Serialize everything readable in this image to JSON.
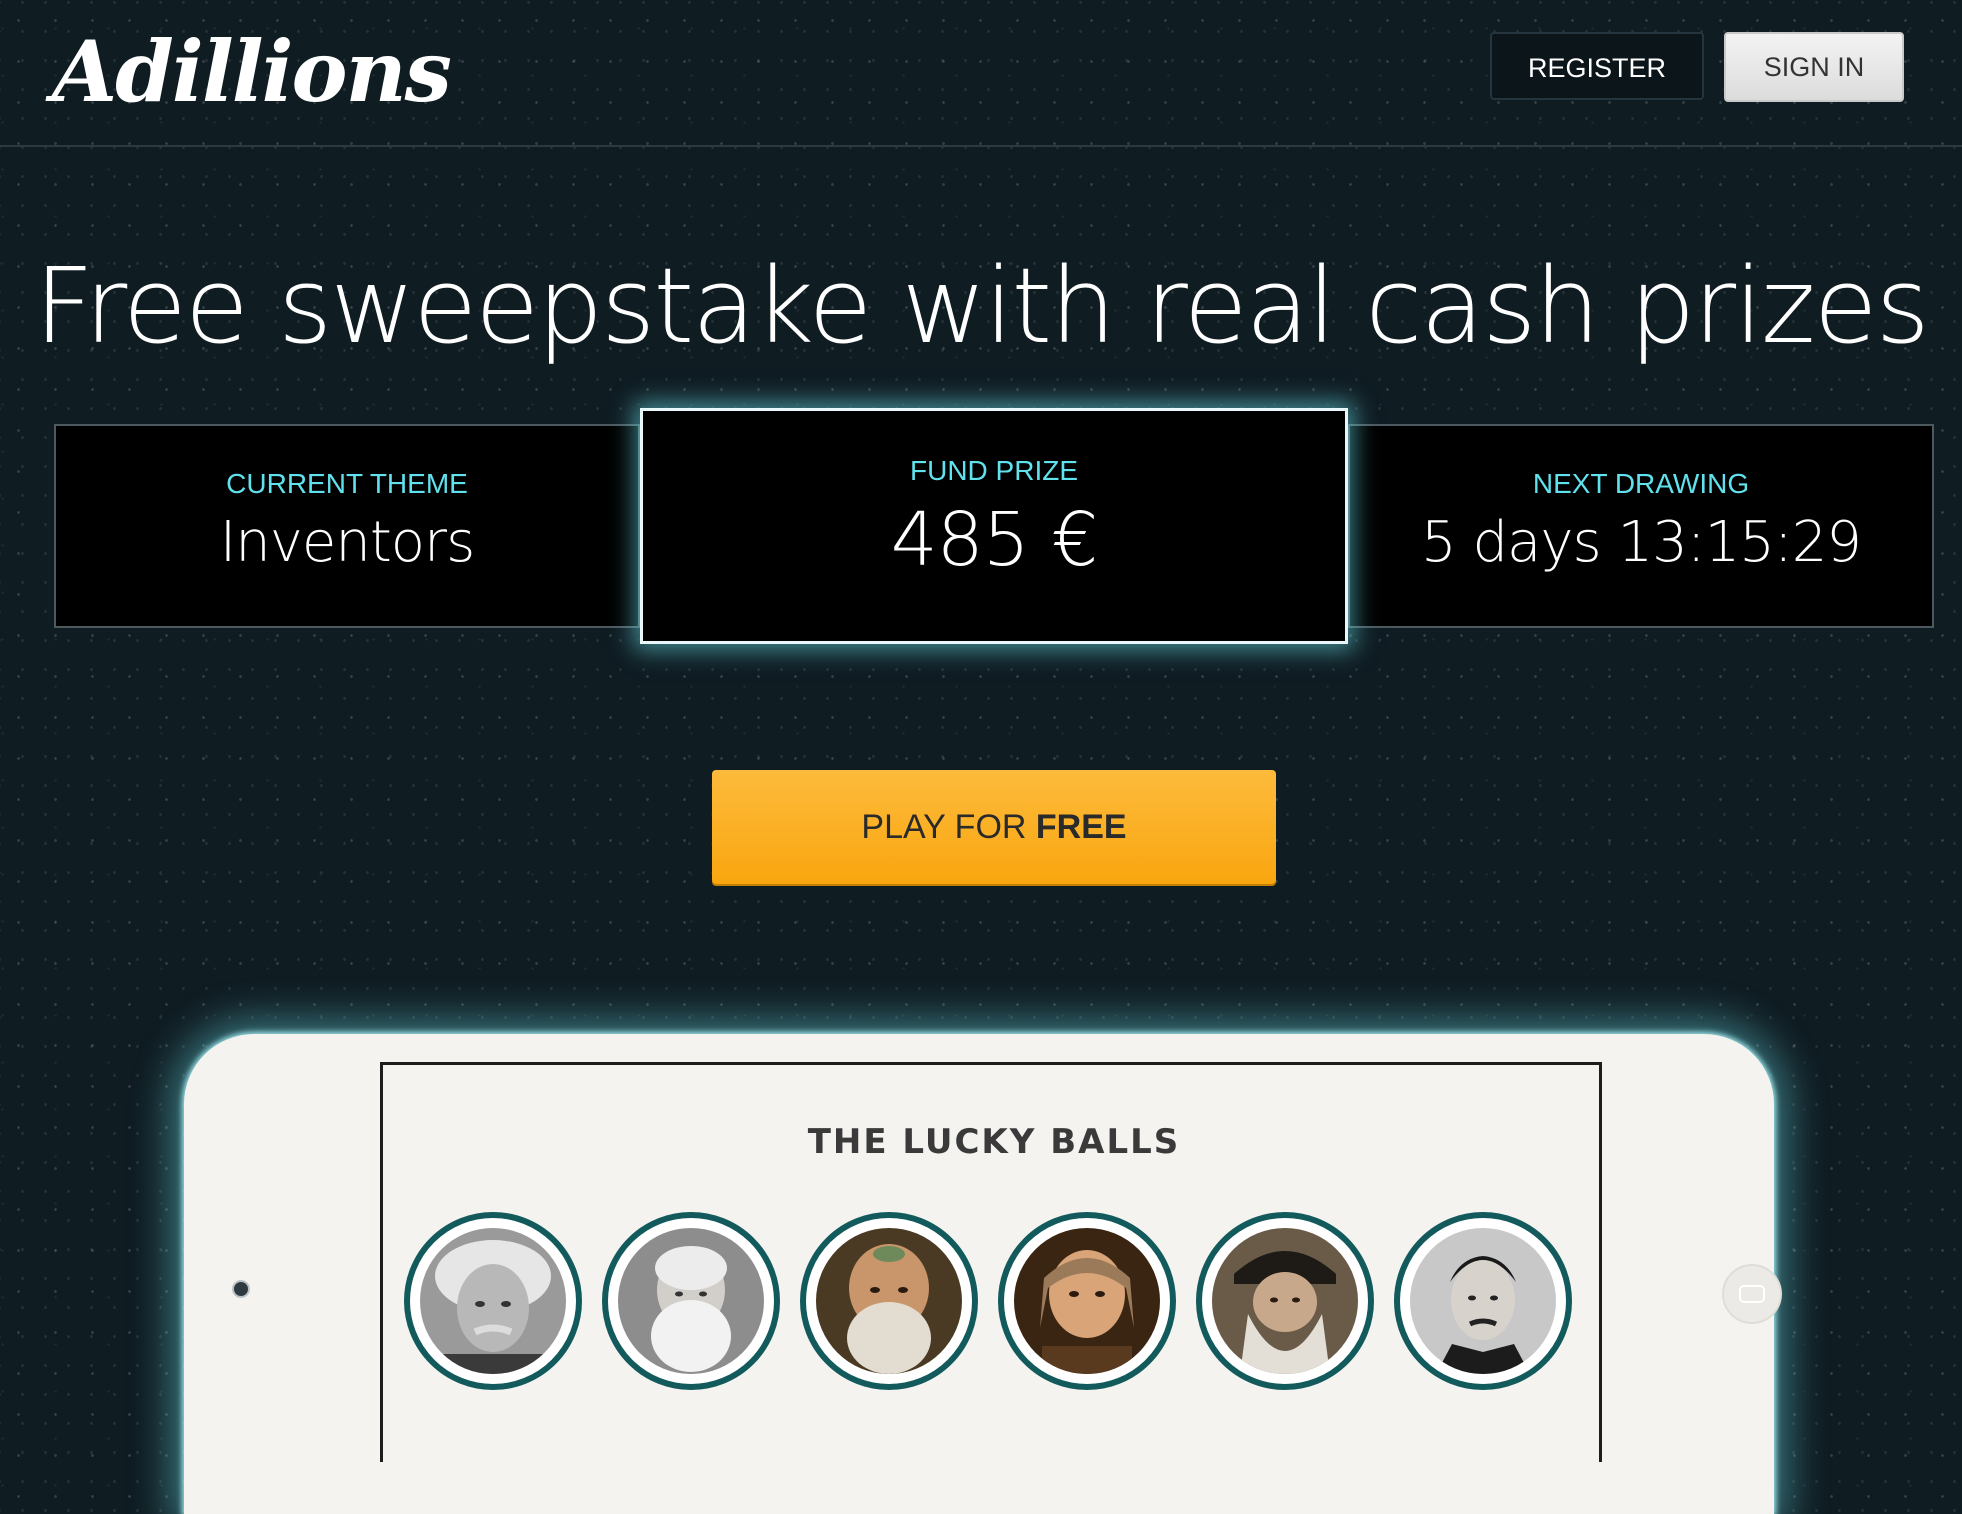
{
  "header": {
    "logo": "Adillions",
    "register_label": "REGISTER",
    "signin_label": "SIGN IN"
  },
  "hero": {
    "title": "Free sweepstake with real cash prizes"
  },
  "stats": {
    "theme": {
      "label": "CURRENT THEME",
      "value": "Inventors"
    },
    "prize": {
      "label": "FUND PRIZE",
      "value": "485 €"
    },
    "drawing": {
      "label": "NEXT DRAWING",
      "value": "5 days 13:15:29"
    }
  },
  "cta": {
    "prefix": "PLAY FOR ",
    "emphasis": "FREE"
  },
  "lucky_balls": {
    "title": "THE LUCKY BALLS",
    "balls": [
      {
        "icon": "portrait-einstein-icon"
      },
      {
        "icon": "portrait-bell-icon"
      },
      {
        "icon": "portrait-archimedes-icon"
      },
      {
        "icon": "portrait-franklin-icon"
      },
      {
        "icon": "portrait-da-vinci-icon"
      },
      {
        "icon": "portrait-tesla-icon"
      }
    ]
  },
  "colors": {
    "background": "#0f1c22",
    "accent_cyan": "#5fe2ee",
    "cta_orange": "#fbb02a",
    "ball_ring": "#125a5c"
  }
}
